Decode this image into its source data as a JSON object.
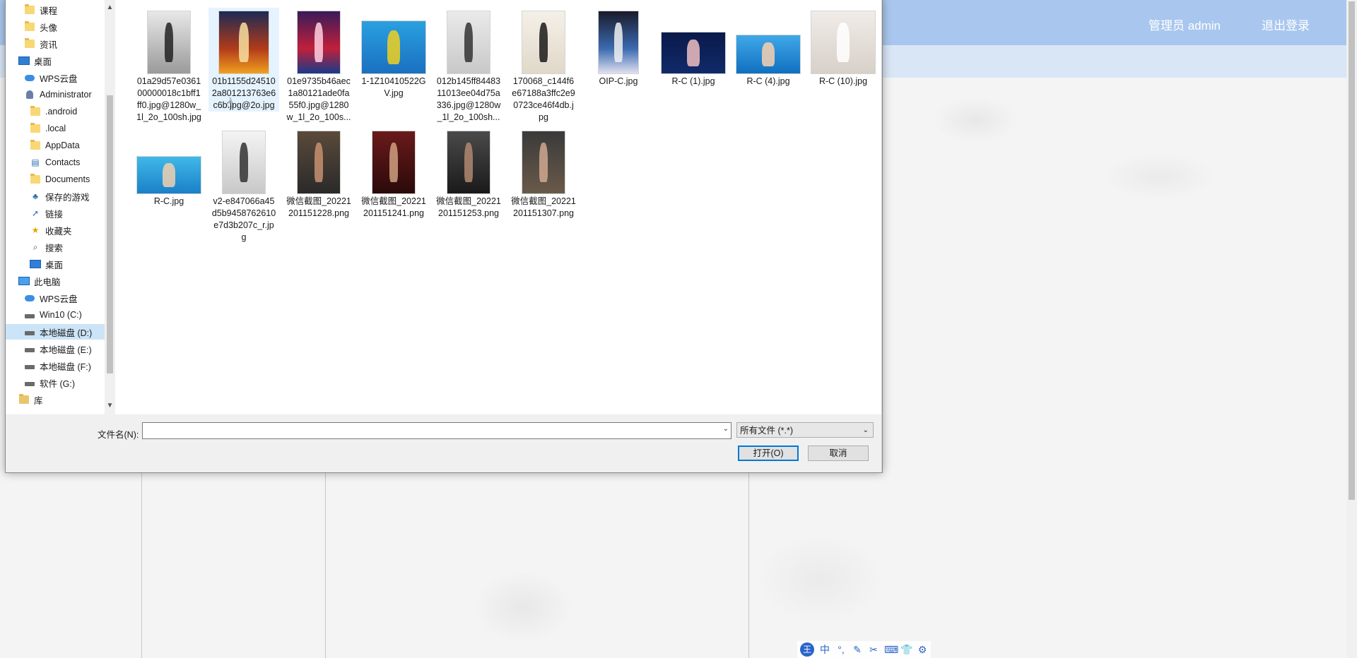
{
  "header": {
    "user_label": "管理员 admin",
    "logout_label": "退出登录"
  },
  "dialog": {
    "nav_items": [
      {
        "label": "课程",
        "icon": "folder-icon",
        "indent": 1
      },
      {
        "label": "头像",
        "icon": "folder-icon",
        "indent": 1
      },
      {
        "label": "资讯",
        "icon": "folder-icon",
        "indent": 1
      },
      {
        "label": "桌面",
        "icon": "desktop-icon",
        "indent": 0
      },
      {
        "label": "WPS云盘",
        "icon": "cloud-icon",
        "indent": 1
      },
      {
        "label": "Administrator",
        "icon": "user-icon",
        "indent": 1
      },
      {
        "label": ".android",
        "icon": "folder-icon",
        "indent": 2
      },
      {
        "label": ".local",
        "icon": "folder-icon",
        "indent": 2
      },
      {
        "label": "AppData",
        "icon": "folder-icon",
        "indent": 2
      },
      {
        "label": "Contacts",
        "icon": "contacts-icon",
        "indent": 2
      },
      {
        "label": "Documents",
        "icon": "folder-icon",
        "indent": 2
      },
      {
        "label": "保存的游戏",
        "icon": "games-icon",
        "indent": 2
      },
      {
        "label": "链接",
        "icon": "link-icon",
        "indent": 2
      },
      {
        "label": "收藏夹",
        "icon": "star-icon",
        "indent": 2
      },
      {
        "label": "搜索",
        "icon": "search-icon",
        "indent": 2
      },
      {
        "label": "桌面",
        "icon": "desktop-icon",
        "indent": 2
      },
      {
        "label": "此电脑",
        "icon": "computer-icon",
        "indent": 0
      },
      {
        "label": "WPS云盘",
        "icon": "cloud-icon",
        "indent": 1
      },
      {
        "label": "Win10 (C:)",
        "icon": "drive-icon",
        "indent": 1
      },
      {
        "label": "本地磁盘 (D:)",
        "icon": "drive-icon",
        "indent": 1,
        "selected": true
      },
      {
        "label": "本地磁盘 (E:)",
        "icon": "drive-icon",
        "indent": 1
      },
      {
        "label": "本地磁盘 (F:)",
        "icon": "drive-icon",
        "indent": 1
      },
      {
        "label": "软件 (G:)",
        "icon": "drive-icon",
        "indent": 1
      },
      {
        "label": "库",
        "icon": "library-icon",
        "indent": 0
      }
    ],
    "files": [
      {
        "name": "01a29d57e036100000018c1bff1ff0.jpg@1280w_1l_2o_100sh.jpg",
        "thumb": "ballet-dark"
      },
      {
        "name": "01b1155d245102a801213763e6c6b.jpg@2o.jpg",
        "thumb": "poster-red",
        "hover": true
      },
      {
        "name": "01e9735b46aec1a80121ade0fa55f0.jpg@1280w_1l_2o_100s...",
        "thumb": "poster-purple"
      },
      {
        "name": "1-1Z10410522GV.jpg",
        "thumb": "swim-pool"
      },
      {
        "name": "012b145ff8448311013ee04d75a336.jpg@1280w_1l_2o_100sh...",
        "thumb": "dancer-grey"
      },
      {
        "name": "170068_c144f6e67188a3ffc2e90723ce46f4db.jpg",
        "thumb": "basketball-poster"
      },
      {
        "name": "OIP-C.jpg",
        "thumb": "poster-hanging"
      },
      {
        "name": "R-C (1).jpg",
        "thumb": "dancer-stage"
      },
      {
        "name": "R-C (4).jpg",
        "thumb": "swimmer-blue"
      },
      {
        "name": "R-C (10).jpg",
        "thumb": "ballerina-white"
      },
      {
        "name": "R-C.jpg",
        "thumb": "swimmer-lane"
      },
      {
        "name": "v2-e847066a45d5b9458762610e7d3b207c_r.jpg",
        "thumb": "ballet-pointe"
      },
      {
        "name": "微信截图_20221201151228.png",
        "thumb": "gym-man-1"
      },
      {
        "name": "微信截图_20221201151241.png",
        "thumb": "gym-man-2"
      },
      {
        "name": "微信截图_20221201151253.png",
        "thumb": "gym-man-3"
      },
      {
        "name": "微信截图_20221201151307.png",
        "thumb": "gym-woman"
      }
    ],
    "filename_label": "文件名(N):",
    "filename_value": "",
    "filetype_selected": "所有文件 (*.*)",
    "open_label": "打开(O)",
    "cancel_label": "取消"
  },
  "ime": [
    "王",
    "中",
    "°,",
    "✎",
    "✂",
    "⌨",
    "👕",
    "⚙"
  ]
}
